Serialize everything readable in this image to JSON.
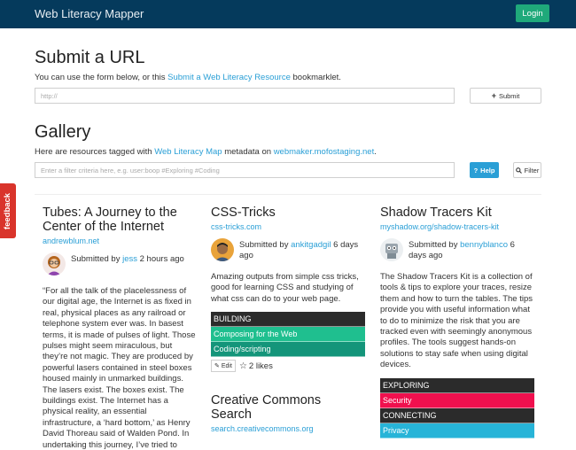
{
  "navbar": {
    "brand": "Web Literacy Mapper",
    "login_label": "Login"
  },
  "colors": {
    "navbar": "#053a5c",
    "login": "#1fa97a",
    "link": "#2a9fd6",
    "feedback": "#d9342b"
  },
  "submit": {
    "heading": "Submit a URL",
    "intro_before": "You can use the form below, or this ",
    "intro_link": "Submit a Web Literacy Resource",
    "intro_after": " bookmarklet.",
    "url_placeholder": "http://",
    "submit_label": "Submit",
    "submit_icon": "plus-icon"
  },
  "gallery": {
    "heading": "Gallery",
    "intro_before": "Here are resources tagged with ",
    "intro_link1": "Web Literacy Map",
    "intro_mid": " metadata on ",
    "intro_link2": "webmaker.mofostaging.net",
    "intro_after": ".",
    "filter_placeholder": "Enter a filter criteria here, e.g. user:boop #Exploring #Coding",
    "help_label": "Help",
    "filter_label": "Filter"
  },
  "feedback_label": "feedback",
  "cards": [
    {
      "title": "Tubes: A Journey to the Center of the Internet",
      "domain": "andrewblum.net",
      "submitted_prefix": "Submitted by ",
      "user": "jess",
      "time": " 2 hours ago",
      "description": "“For all the talk of the placelessness of our digital age, the Internet is as fixed in real, physical places as any railroad or telephone system ever was. In basest terms, it is made of pulses of light. Those pulses might seem miraculous, but they’re not magic. They are produced by powerful lasers contained in steel boxes housed mainly in unmarked buildings. The lasers exist. The boxes exist. The buildings exist. The Internet has a physical reality, an essential infrastructure, a ‘hard bottom,’ as Henry David Thoreau said of Walden Pond. In undertaking this journey, I’ve tried to"
    },
    {
      "title": "CSS-Tricks",
      "domain": "css-tricks.com",
      "submitted_prefix": "Submitted by ",
      "user": "ankitgadgil",
      "time": " 6 days ago",
      "description": "Amazing outputs from simple css tricks, good for learning CSS and studying of what css can do to your web page.",
      "tags": [
        {
          "label": "BUILDING",
          "type": "category",
          "color": "#2b2b2b"
        },
        {
          "label": "Composing for the Web",
          "type": "skill",
          "color": "#1fbf8f"
        },
        {
          "label": "Coding/scripting",
          "type": "skill",
          "color": "#14957a"
        }
      ],
      "edit_label": "Edit",
      "likes": "2 likes"
    },
    {
      "title": "Shadow Tracers Kit",
      "domain": "myshadow.org/shadow-tracers-kit",
      "submitted_prefix": "Submitted by ",
      "user": "bennyblanco",
      "time": " 6 days ago",
      "description": "The Shadow Tracers Kit is a collection of tools & tips to explore your traces, resize them and how to turn the tables. The tips provide you with useful information what to do to minimize the risk that you are tracked even with seemingly anonymous profiles. The tools suggest hands-on solutions to stay safe when using digital devices.",
      "tags": [
        {
          "label": "EXPLORING",
          "type": "category",
          "color": "#2b2b2b"
        },
        {
          "label": "Security",
          "type": "skill",
          "color": "#f0104e"
        },
        {
          "label": "CONNECTING",
          "type": "category",
          "color": "#2b2b2b"
        },
        {
          "label": "Privacy",
          "type": "skill",
          "color": "#27b4d8"
        }
      ]
    },
    {
      "title": "Creative Commons Search",
      "domain": "search.creativecommons.org"
    }
  ]
}
